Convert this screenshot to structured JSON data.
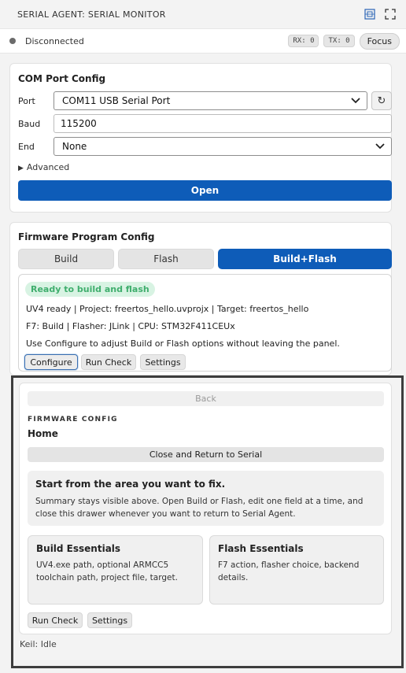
{
  "header": {
    "title": "SERIAL AGENT: SERIAL MONITOR",
    "icons": [
      "screenshot-icon",
      "fullscreen-icon"
    ]
  },
  "status": {
    "text": "Disconnected",
    "rx": "RX: 0",
    "tx": "TX: 0",
    "focus_label": "Focus"
  },
  "com_config": {
    "title": "COM Port Config",
    "port_label": "Port",
    "port_value": "COM11 USB Serial Port",
    "baud_label": "Baud",
    "baud_value": "115200",
    "end_label": "End",
    "end_value": "None",
    "advanced_label": "Advanced",
    "open_label": "Open"
  },
  "firmware": {
    "title": "Firmware Program Config",
    "modes": [
      "Build",
      "Flash",
      "Build+Flash"
    ],
    "active_mode": "Build+Flash",
    "badge": "Ready to build and flash",
    "line1": "UV4 ready | Project: freertos_hello.uvprojx | Target: freertos_hello",
    "line2": "F7: Build | Flasher: JLink | CPU: STM32F411CEUx",
    "line3": "Use Configure to adjust Build or Flash options without leaving the panel.",
    "buttons": [
      "Configure",
      "Run Check",
      "Settings"
    ]
  },
  "drawer": {
    "back_label": "Back",
    "eyebrow": "FIRMWARE CONFIG",
    "title": "Home",
    "close_label": "Close and Return to Serial",
    "intro_title": "Start from the area you want to fix.",
    "intro_text": "Summary stays visible above. Open Build or Flash, edit one field at a time, and close this drawer whenever you want to return to Serial Agent.",
    "build_title": "Build Essentials",
    "build_text": "UV4.exe path, optional ARMCC5 toolchain path, project file, target.",
    "flash_title": "Flash Essentials",
    "flash_text": "F7 action, flasher choice, backend details.",
    "buttons": [
      "Run Check",
      "Settings"
    ]
  },
  "footer": {
    "keil_status": "Keil: Idle"
  },
  "colors": {
    "accent": "#0e5cb8",
    "ready_bg": "#d8f3e3",
    "ready_text": "#3fae6d",
    "status_dot": "#6b6b6b"
  }
}
